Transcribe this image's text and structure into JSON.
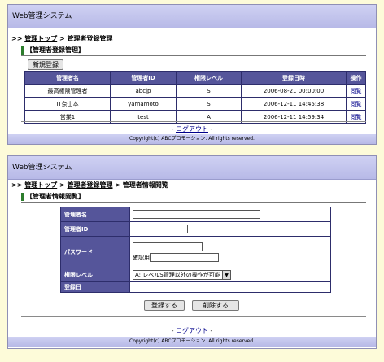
{
  "app_title": "Web管理システム",
  "list_page": {
    "breadcrumb": {
      "prefix": ">>",
      "top": "管理トップ",
      "sep": ">",
      "current": "管理者登録管理"
    },
    "section_title": "【管理者登録管理】",
    "new_button": "新規登録",
    "columns": [
      "管理者名",
      "管理者ID",
      "権限レベル",
      "登録日時",
      "操作"
    ],
    "rows": [
      {
        "name": "最高権限管理者",
        "id": "abcjp",
        "level": "S",
        "date": "2006-08-21 00:00:00",
        "action": "閲覧"
      },
      {
        "name": "IT奈山本",
        "id": "yamamoto",
        "level": "S",
        "date": "2006-12-11 14:45:38",
        "action": "閲覧"
      },
      {
        "name": "営業1",
        "id": "test",
        "level": "A",
        "date": "2006-12-11 14:59:34",
        "action": "閲覧"
      }
    ],
    "logout": "ログアウト",
    "logout_dash": "-",
    "copyright": "Copyright(c) ABCプロモーション. All rights reserved."
  },
  "detail_page": {
    "breadcrumb": {
      "prefix": ">>",
      "top": "管理トップ",
      "sep": ">",
      "mid": "管理者登録管理",
      "current": "管理者情報閲覧"
    },
    "section_title": "【管理者情報閲覧】",
    "labels": {
      "name": "管理者名",
      "id": "管理者ID",
      "password": "パスワード",
      "confirm": "確認用",
      "level": "権限レベル",
      "registered": "登録日"
    },
    "values": {
      "name": "",
      "id": "",
      "password": "",
      "confirm": "",
      "level": "A: レベルS管理以外の操作が可能",
      "registered": ""
    },
    "register_button": "登録する",
    "delete_button": "削除する",
    "logout": "ログアウト",
    "logout_dash": "-",
    "copyright": "Copyright(c) ABCプロモーション. All rights reserved."
  }
}
